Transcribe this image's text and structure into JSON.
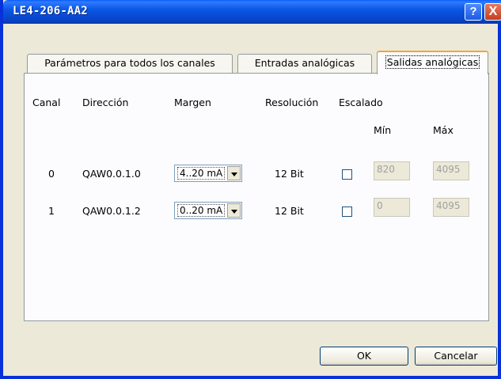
{
  "window": {
    "title": "LE4-206-AA2",
    "help_glyph": "?",
    "close_glyph": "X"
  },
  "tabs": [
    {
      "label": "Parámetros para todos los canales"
    },
    {
      "label": "Entradas analógicas"
    },
    {
      "label": "Salidas analógicas",
      "selected": true
    }
  ],
  "headers": {
    "channel": "Canal",
    "address": "Dirección",
    "range": "Margen",
    "resolution": "Resolución",
    "scaling": "Escalado",
    "min": "Mín",
    "max": "Máx"
  },
  "rows": [
    {
      "channel": "0",
      "address": "QAW0.0.1.0",
      "range": "4..20 mA",
      "resolution": "12 Bit",
      "scaled": false,
      "min": "820",
      "max": "4095"
    },
    {
      "channel": "1",
      "address": "QAW0.0.1.2",
      "range": "0..20 mA",
      "resolution": "12 Bit",
      "scaled": false,
      "min": "0",
      "max": "4095"
    }
  ],
  "buttons": {
    "ok": "OK",
    "cancel": "Cancelar"
  },
  "colors": {
    "titlebar": "#0a57e6",
    "dialog_bg": "#ece9d8",
    "selected_tab_accent": "#f6a336"
  }
}
